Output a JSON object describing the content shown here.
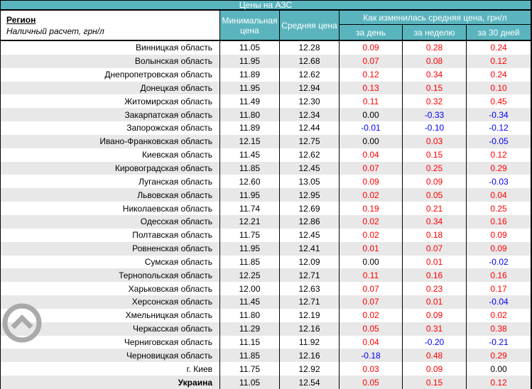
{
  "title": "Цены на АЗС",
  "header": {
    "region_label": "Регион",
    "region_sub": "Наличный расчет, грн/л",
    "col_min": "Минимальная цена",
    "col_avg": "Средняя цена",
    "group": "Как изменилась средняя цена, грн/л",
    "col_day": "за день",
    "col_week": "за неделю",
    "col_30d": "за 30 дней"
  },
  "colors": {
    "teal_header": "#5ab4be",
    "alt_row": "#e8e8e8",
    "positive_change": "#ff0000",
    "negative_change": "#0000ff",
    "border": "#000000",
    "scroll_icon_gray": "#a3a3a3"
  },
  "icons": {
    "scroll_top": "chevron-up-circle-icon"
  },
  "rows": [
    {
      "region": "Винницкая область",
      "min": "11.05",
      "avg": "12.28",
      "day": "0.09",
      "week": "0.28",
      "d30": "0.24"
    },
    {
      "region": "Волынская область",
      "min": "11.95",
      "avg": "12.68",
      "day": "0.07",
      "week": "0.08",
      "d30": "0.12"
    },
    {
      "region": "Днепропетровская область",
      "min": "11.89",
      "avg": "12.62",
      "day": "0.12",
      "week": "0.34",
      "d30": "0.24"
    },
    {
      "region": "Донецкая область",
      "min": "11.95",
      "avg": "12.94",
      "day": "0.13",
      "week": "0.15",
      "d30": "0.10"
    },
    {
      "region": "Житомирская область",
      "min": "11.49",
      "avg": "12.30",
      "day": "0.11",
      "week": "0.32",
      "d30": "0.45"
    },
    {
      "region": "Закарпатская область",
      "min": "11.80",
      "avg": "12.34",
      "day": "0.00",
      "week": "-0.33",
      "d30": "-0.34"
    },
    {
      "region": "Запорожская область",
      "min": "11.89",
      "avg": "12.44",
      "day": "-0.01",
      "week": "-0.10",
      "d30": "-0.12"
    },
    {
      "region": "Ивано-Франковская область",
      "min": "12.15",
      "avg": "12.75",
      "day": "0.00",
      "week": "0.03",
      "d30": "-0.05"
    },
    {
      "region": "Киевская область",
      "min": "11.45",
      "avg": "12.62",
      "day": "0.04",
      "week": "0.15",
      "d30": "0.12"
    },
    {
      "region": "Кировоградская область",
      "min": "11.85",
      "avg": "12.45",
      "day": "0.07",
      "week": "0.25",
      "d30": "0.29"
    },
    {
      "region": "Луганская область",
      "min": "12.60",
      "avg": "13.05",
      "day": "0.09",
      "week": "0.09",
      "d30": "-0.03"
    },
    {
      "region": "Львовская область",
      "min": "11.95",
      "avg": "12.95",
      "day": "0.02",
      "week": "0.05",
      "d30": "0.04"
    },
    {
      "region": "Николаевская область",
      "min": "11.74",
      "avg": "12.69",
      "day": "0.19",
      "week": "0.21",
      "d30": "0.25"
    },
    {
      "region": "Одесская область",
      "min": "12.21",
      "avg": "12.86",
      "day": "0.02",
      "week": "0.34",
      "d30": "0.16"
    },
    {
      "region": "Полтавская область",
      "min": "11.75",
      "avg": "12.45",
      "day": "0.02",
      "week": "0.18",
      "d30": "0.09"
    },
    {
      "region": "Ровненская область",
      "min": "11.95",
      "avg": "12.41",
      "day": "0.01",
      "week": "0.07",
      "d30": "0.09"
    },
    {
      "region": "Сумская область",
      "min": "11.85",
      "avg": "12.09",
      "day": "0.00",
      "week": "0.01",
      "d30": "-0.02"
    },
    {
      "region": "Тернопольская область",
      "min": "12.25",
      "avg": "12.71",
      "day": "0.11",
      "week": "0.16",
      "d30": "0.16"
    },
    {
      "region": "Харьковская область",
      "min": "12.00",
      "avg": "12.63",
      "day": "0.07",
      "week": "0.23",
      "d30": "0.17"
    },
    {
      "region": "Херсонская область",
      "min": "11.45",
      "avg": "12.71",
      "day": "0.07",
      "week": "0.01",
      "d30": "-0.04"
    },
    {
      "region": "Хмельницкая область",
      "min": "11.80",
      "avg": "12.19",
      "day": "0.02",
      "week": "0.09",
      "d30": "0.02"
    },
    {
      "region": "Черкасская область",
      "min": "11.29",
      "avg": "12.16",
      "day": "0.05",
      "week": "0.31",
      "d30": "0.38"
    },
    {
      "region": "Черниговская область",
      "min": "11.15",
      "avg": "11.92",
      "day": "0.04",
      "week": "-0.20",
      "d30": "-0.21"
    },
    {
      "region": "Черновицкая область",
      "min": "11.85",
      "avg": "12.16",
      "day": "-0.18",
      "week": "0.48",
      "d30": "0.29"
    },
    {
      "region": "г. Киев",
      "min": "11.75",
      "avg": "12.92",
      "day": "0.03",
      "week": "0.09",
      "d30": "0.00"
    },
    {
      "region": "Украина",
      "min": "11.05",
      "avg": "12.54",
      "day": "0.05",
      "week": "0.15",
      "d30": "0.12",
      "bold": true
    }
  ]
}
